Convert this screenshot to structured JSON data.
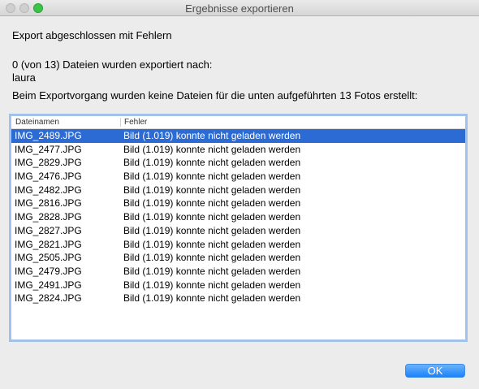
{
  "window": {
    "title": "Ergebnisse exportieren"
  },
  "message": {
    "status": "Export abgeschlossen mit Fehlern",
    "count_line": "0 (von 13) Dateien wurden exportiert nach:",
    "destination": "laura",
    "info": "Beim Exportvorgang wurden keine Dateien für die unten aufgeführten 13 Fotos erstellt:"
  },
  "table": {
    "columns": [
      "Dateinamen",
      "Fehler"
    ],
    "selected_index": 0,
    "rows": [
      {
        "file": "IMG_2489.JPG",
        "error": "Bild (1.019) konnte nicht geladen werden"
      },
      {
        "file": "IMG_2477.JPG",
        "error": "Bild (1.019) konnte nicht geladen werden"
      },
      {
        "file": "IMG_2829.JPG",
        "error": "Bild (1.019) konnte nicht geladen werden"
      },
      {
        "file": "IMG_2476.JPG",
        "error": "Bild (1.019) konnte nicht geladen werden"
      },
      {
        "file": "IMG_2482.JPG",
        "error": "Bild (1.019) konnte nicht geladen werden"
      },
      {
        "file": "IMG_2816.JPG",
        "error": "Bild (1.019) konnte nicht geladen werden"
      },
      {
        "file": "IMG_2828.JPG",
        "error": "Bild (1.019) konnte nicht geladen werden"
      },
      {
        "file": "IMG_2827.JPG",
        "error": "Bild (1.019) konnte nicht geladen werden"
      },
      {
        "file": "IMG_2821.JPG",
        "error": "Bild (1.019) konnte nicht geladen werden"
      },
      {
        "file": "IMG_2505.JPG",
        "error": "Bild (1.019) konnte nicht geladen werden"
      },
      {
        "file": "IMG_2479.JPG",
        "error": "Bild (1.019) konnte nicht geladen werden"
      },
      {
        "file": "IMG_2491.JPG",
        "error": "Bild (1.019) konnte nicht geladen werden"
      },
      {
        "file": "IMG_2824.JPG",
        "error": "Bild (1.019) konnte nicht geladen werden"
      }
    ]
  },
  "buttons": {
    "ok_label": "OK"
  },
  "colors": {
    "selection": "#2c6bd3",
    "accent_button": "#1a82fb",
    "window_bg": "#ececec"
  }
}
